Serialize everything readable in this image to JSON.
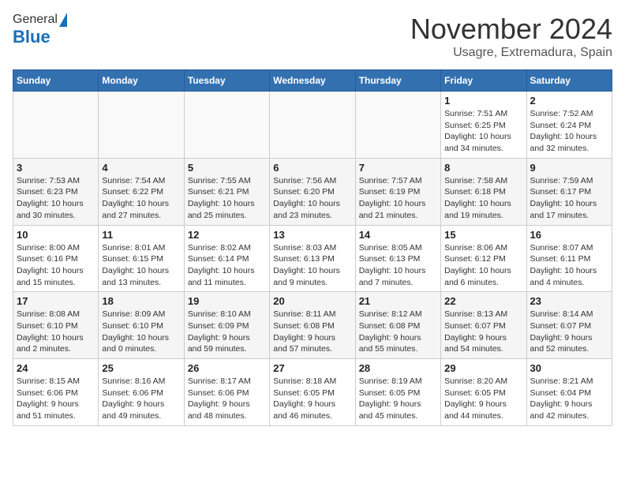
{
  "header": {
    "logo_general": "General",
    "logo_blue": "Blue",
    "month_title": "November 2024",
    "location": "Usagre, Extremadura, Spain"
  },
  "weekdays": [
    "Sunday",
    "Monday",
    "Tuesday",
    "Wednesday",
    "Thursday",
    "Friday",
    "Saturday"
  ],
  "weeks": [
    [
      {
        "day": "",
        "info": ""
      },
      {
        "day": "",
        "info": ""
      },
      {
        "day": "",
        "info": ""
      },
      {
        "day": "",
        "info": ""
      },
      {
        "day": "",
        "info": ""
      },
      {
        "day": "1",
        "info": "Sunrise: 7:51 AM\nSunset: 6:25 PM\nDaylight: 10 hours\nand 34 minutes."
      },
      {
        "day": "2",
        "info": "Sunrise: 7:52 AM\nSunset: 6:24 PM\nDaylight: 10 hours\nand 32 minutes."
      }
    ],
    [
      {
        "day": "3",
        "info": "Sunrise: 7:53 AM\nSunset: 6:23 PM\nDaylight: 10 hours\nand 30 minutes."
      },
      {
        "day": "4",
        "info": "Sunrise: 7:54 AM\nSunset: 6:22 PM\nDaylight: 10 hours\nand 27 minutes."
      },
      {
        "day": "5",
        "info": "Sunrise: 7:55 AM\nSunset: 6:21 PM\nDaylight: 10 hours\nand 25 minutes."
      },
      {
        "day": "6",
        "info": "Sunrise: 7:56 AM\nSunset: 6:20 PM\nDaylight: 10 hours\nand 23 minutes."
      },
      {
        "day": "7",
        "info": "Sunrise: 7:57 AM\nSunset: 6:19 PM\nDaylight: 10 hours\nand 21 minutes."
      },
      {
        "day": "8",
        "info": "Sunrise: 7:58 AM\nSunset: 6:18 PM\nDaylight: 10 hours\nand 19 minutes."
      },
      {
        "day": "9",
        "info": "Sunrise: 7:59 AM\nSunset: 6:17 PM\nDaylight: 10 hours\nand 17 minutes."
      }
    ],
    [
      {
        "day": "10",
        "info": "Sunrise: 8:00 AM\nSunset: 6:16 PM\nDaylight: 10 hours\nand 15 minutes."
      },
      {
        "day": "11",
        "info": "Sunrise: 8:01 AM\nSunset: 6:15 PM\nDaylight: 10 hours\nand 13 minutes."
      },
      {
        "day": "12",
        "info": "Sunrise: 8:02 AM\nSunset: 6:14 PM\nDaylight: 10 hours\nand 11 minutes."
      },
      {
        "day": "13",
        "info": "Sunrise: 8:03 AM\nSunset: 6:13 PM\nDaylight: 10 hours\nand 9 minutes."
      },
      {
        "day": "14",
        "info": "Sunrise: 8:05 AM\nSunset: 6:13 PM\nDaylight: 10 hours\nand 7 minutes."
      },
      {
        "day": "15",
        "info": "Sunrise: 8:06 AM\nSunset: 6:12 PM\nDaylight: 10 hours\nand 6 minutes."
      },
      {
        "day": "16",
        "info": "Sunrise: 8:07 AM\nSunset: 6:11 PM\nDaylight: 10 hours\nand 4 minutes."
      }
    ],
    [
      {
        "day": "17",
        "info": "Sunrise: 8:08 AM\nSunset: 6:10 PM\nDaylight: 10 hours\nand 2 minutes."
      },
      {
        "day": "18",
        "info": "Sunrise: 8:09 AM\nSunset: 6:10 PM\nDaylight: 10 hours\nand 0 minutes."
      },
      {
        "day": "19",
        "info": "Sunrise: 8:10 AM\nSunset: 6:09 PM\nDaylight: 9 hours\nand 59 minutes."
      },
      {
        "day": "20",
        "info": "Sunrise: 8:11 AM\nSunset: 6:08 PM\nDaylight: 9 hours\nand 57 minutes."
      },
      {
        "day": "21",
        "info": "Sunrise: 8:12 AM\nSunset: 6:08 PM\nDaylight: 9 hours\nand 55 minutes."
      },
      {
        "day": "22",
        "info": "Sunrise: 8:13 AM\nSunset: 6:07 PM\nDaylight: 9 hours\nand 54 minutes."
      },
      {
        "day": "23",
        "info": "Sunrise: 8:14 AM\nSunset: 6:07 PM\nDaylight: 9 hours\nand 52 minutes."
      }
    ],
    [
      {
        "day": "24",
        "info": "Sunrise: 8:15 AM\nSunset: 6:06 PM\nDaylight: 9 hours\nand 51 minutes."
      },
      {
        "day": "25",
        "info": "Sunrise: 8:16 AM\nSunset: 6:06 PM\nDaylight: 9 hours\nand 49 minutes."
      },
      {
        "day": "26",
        "info": "Sunrise: 8:17 AM\nSunset: 6:06 PM\nDaylight: 9 hours\nand 48 minutes."
      },
      {
        "day": "27",
        "info": "Sunrise: 8:18 AM\nSunset: 6:05 PM\nDaylight: 9 hours\nand 46 minutes."
      },
      {
        "day": "28",
        "info": "Sunrise: 8:19 AM\nSunset: 6:05 PM\nDaylight: 9 hours\nand 45 minutes."
      },
      {
        "day": "29",
        "info": "Sunrise: 8:20 AM\nSunset: 6:05 PM\nDaylight: 9 hours\nand 44 minutes."
      },
      {
        "day": "30",
        "info": "Sunrise: 8:21 AM\nSunset: 6:04 PM\nDaylight: 9 hours\nand 42 minutes."
      }
    ]
  ]
}
